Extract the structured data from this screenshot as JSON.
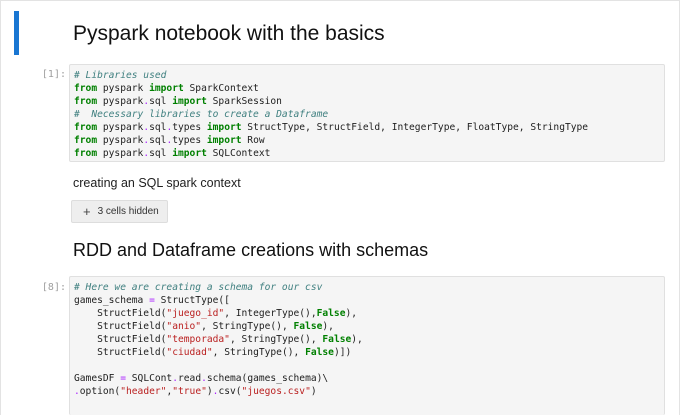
{
  "notebook": {
    "title": "Pyspark notebook with the basics",
    "cells": [
      {
        "prompt": "[1]:",
        "lines": [
          [
            {
              "t": "cm",
              "v": "# Libraries used"
            }
          ],
          [
            {
              "t": "kw",
              "v": "from"
            },
            {
              "t": "n",
              "v": " pyspark "
            },
            {
              "t": "kw",
              "v": "import"
            },
            {
              "t": "n",
              "v": " SparkContext"
            }
          ],
          [
            {
              "t": "kw",
              "v": "from"
            },
            {
              "t": "n",
              "v": " pyspark"
            },
            {
              "t": "op",
              "v": "."
            },
            {
              "t": "n",
              "v": "sql "
            },
            {
              "t": "kw",
              "v": "import"
            },
            {
              "t": "n",
              "v": " SparkSession"
            }
          ],
          [
            {
              "t": "cm",
              "v": "#  Necessary libraries to create a Dataframe"
            }
          ],
          [
            {
              "t": "kw",
              "v": "from"
            },
            {
              "t": "n",
              "v": " pyspark"
            },
            {
              "t": "op",
              "v": "."
            },
            {
              "t": "n",
              "v": "sql"
            },
            {
              "t": "op",
              "v": "."
            },
            {
              "t": "n",
              "v": "types "
            },
            {
              "t": "kw",
              "v": "import"
            },
            {
              "t": "n",
              "v": " StructType, StructField, IntegerType, FloatType, StringType"
            }
          ],
          [
            {
              "t": "kw",
              "v": "from"
            },
            {
              "t": "n",
              "v": " pyspark"
            },
            {
              "t": "op",
              "v": "."
            },
            {
              "t": "n",
              "v": "sql"
            },
            {
              "t": "op",
              "v": "."
            },
            {
              "t": "n",
              "v": "types "
            },
            {
              "t": "kw",
              "v": "import"
            },
            {
              "t": "n",
              "v": " Row"
            }
          ],
          [
            {
              "t": "kw",
              "v": "from"
            },
            {
              "t": "n",
              "v": " pyspark"
            },
            {
              "t": "op",
              "v": "."
            },
            {
              "t": "n",
              "v": "sql "
            },
            {
              "t": "kw",
              "v": "import"
            },
            {
              "t": "n",
              "v": " SQLContext"
            }
          ]
        ]
      },
      {
        "prompt": "[8]:",
        "lines": [
          [
            {
              "t": "cm",
              "v": "# Here we are creating a schema for our csv"
            }
          ],
          [
            {
              "t": "n",
              "v": "games_schema "
            },
            {
              "t": "op",
              "v": "="
            },
            {
              "t": "n",
              "v": " StructType(["
            }
          ],
          [
            {
              "t": "n",
              "v": "    StructField("
            },
            {
              "t": "st",
              "v": "\"juego_id\""
            },
            {
              "t": "n",
              "v": ", IntegerType(),"
            },
            {
              "t": "kw",
              "v": "False"
            },
            {
              "t": "n",
              "v": "),"
            }
          ],
          [
            {
              "t": "n",
              "v": "    StructField("
            },
            {
              "t": "st",
              "v": "\"anio\""
            },
            {
              "t": "n",
              "v": ", StringType(), "
            },
            {
              "t": "kw",
              "v": "False"
            },
            {
              "t": "n",
              "v": "),"
            }
          ],
          [
            {
              "t": "n",
              "v": "    StructField("
            },
            {
              "t": "st",
              "v": "\"temporada\""
            },
            {
              "t": "n",
              "v": ", StringType(), "
            },
            {
              "t": "kw",
              "v": "False"
            },
            {
              "t": "n",
              "v": "),"
            }
          ],
          [
            {
              "t": "n",
              "v": "    StructField("
            },
            {
              "t": "st",
              "v": "\"ciudad\""
            },
            {
              "t": "n",
              "v": ", StringType(), "
            },
            {
              "t": "kw",
              "v": "False"
            },
            {
              "t": "n",
              "v": ")])"
            }
          ],
          [],
          [
            {
              "t": "n",
              "v": "GamesDF "
            },
            {
              "t": "op",
              "v": "="
            },
            {
              "t": "n",
              "v": " SQLCont"
            },
            {
              "t": "op",
              "v": "."
            },
            {
              "t": "n",
              "v": "read"
            },
            {
              "t": "op",
              "v": "."
            },
            {
              "t": "n",
              "v": "schema(games_schema)\\"
            }
          ],
          [
            {
              "t": "op",
              "v": "."
            },
            {
              "t": "n",
              "v": "option("
            },
            {
              "t": "st",
              "v": "\"header\""
            },
            {
              "t": "n",
              "v": ","
            },
            {
              "t": "st",
              "v": "\"true\""
            },
            {
              "t": "n",
              "v": ")"
            },
            {
              "t": "op",
              "v": "."
            },
            {
              "t": "n",
              "v": "csv("
            },
            {
              "t": "st",
              "v": "\"juegos.csv\""
            },
            {
              "t": "n",
              "v": ")"
            }
          ]
        ]
      }
    ],
    "markdown_text": "creating an SQL spark context",
    "hidden_cells_label": "3 cells hidden",
    "heading2": "RDD and Dataframe creations with schemas"
  },
  "colors": {
    "active_bar": "#1976d2",
    "comment": "#408080",
    "keyword": "#008000",
    "string": "#ba2121",
    "operator": "#aa22ff"
  },
  "icons": {
    "expand": "plus-icon"
  }
}
